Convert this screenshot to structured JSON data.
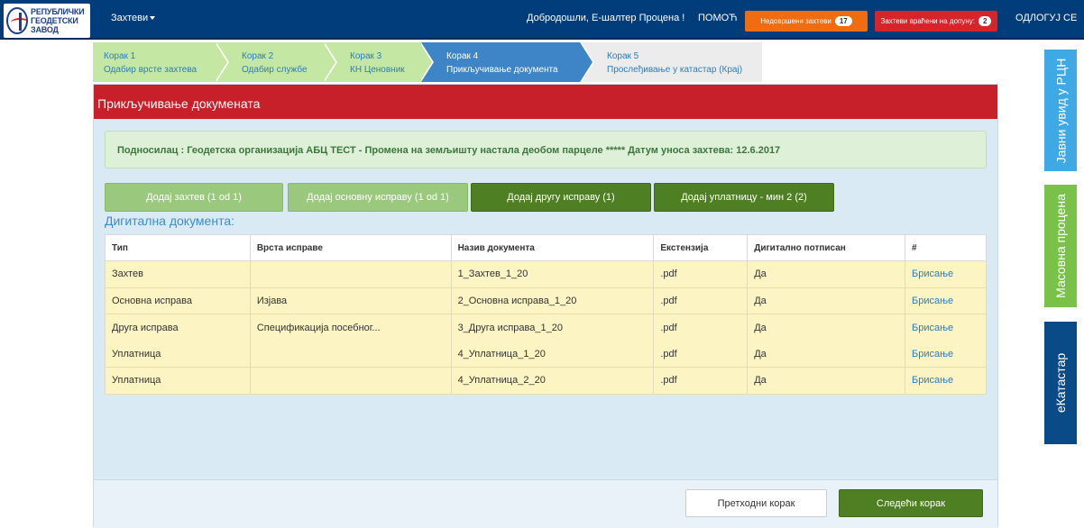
{
  "navbar": {
    "logo_line1": "РЕПУБЛИЧКИ",
    "logo_line2": "ГЕОДЕТСКИ ЗАВОД",
    "dropdown_label": "Захтеви",
    "welcome": "Добродошли, Е-шалтер Процена !",
    "help": "ПОМОЋ",
    "unfinished_label": "Недовршени захтеви",
    "unfinished_count": "17",
    "returned_label": "Захтеви враћени на допуну:",
    "returned_count": "2",
    "logout": "ОДЛОГУЈ СЕ"
  },
  "steps": [
    {
      "title": "Корак 1",
      "subtitle": "Одабир врсте захтева",
      "state": "done"
    },
    {
      "title": "Корак 2",
      "subtitle": "Одабир службе",
      "state": "done"
    },
    {
      "title": "Корак 3",
      "subtitle": "КН Ценовник",
      "state": "done"
    },
    {
      "title": "Корак 4",
      "subtitle": "Прикључивање документа",
      "state": "active"
    },
    {
      "title": "Корак 5",
      "subtitle": "Прослеђивање у катастар (Крај)",
      "state": "pending"
    }
  ],
  "side_tabs": {
    "rgz": "Јавни увид у РЦН",
    "mass": "Масовна процена",
    "ekatastar": "еКатастар"
  },
  "panel": {
    "title": "Прикључивање докумената",
    "info": "Подносилац : Геодетска организација АБЦ ТЕСТ - Промена на земљишту настала деобом парцеле ***** Датум уноса захтева: 12.6.2017",
    "buttons": {
      "add_request": "Додај захтев (1 od 1)",
      "add_main_doc": "Додај основну исправу (1 od 1)",
      "add_other_doc": "Додај другу исправу (1)",
      "add_payment": "Додај уплатницу - мин 2 (2)"
    },
    "section_title": "Дигитална документа:",
    "table": {
      "headers": [
        "Тип",
        "Врста исправе",
        "Назив документа",
        "Екстензија",
        "Дигитално потписан",
        "#"
      ],
      "rows": [
        {
          "type": "Захтев",
          "kind": "",
          "name": "1_Захтев_1_20",
          "ext": ".pdf",
          "signed": "Да",
          "action": "Брисање"
        },
        {
          "type": "Основна исправа",
          "kind": "Изјава",
          "name": "2_Основна исправа_1_20",
          "ext": ".pdf",
          "signed": "Да",
          "action": "Брисање"
        },
        {
          "type": "Друга исправа",
          "kind": "Спецификација посебног...",
          "name": "3_Друга исправа_1_20",
          "ext": ".pdf",
          "signed": "Да",
          "action": "Брисање"
        },
        {
          "type": "Уплатница",
          "kind": "",
          "name": "4_Уплатница_1_20",
          "ext": ".pdf",
          "signed": "Да",
          "action": "Брисање"
        },
        {
          "type": "Уплатница",
          "kind": "",
          "name": "4_Уплатница_2_20",
          "ext": ".pdf",
          "signed": "Да",
          "action": "Брисање"
        }
      ]
    },
    "footer": {
      "prev": "Претходни корак",
      "next": "Следећи корак"
    }
  },
  "colors": {
    "navbar": "#003d7a",
    "header_red": "#c8202a",
    "btn_green_dark": "#4e7f22",
    "btn_green_light": "#9ac87c",
    "step_active": "#3d85c6",
    "step_done": "#c4e8a4"
  }
}
